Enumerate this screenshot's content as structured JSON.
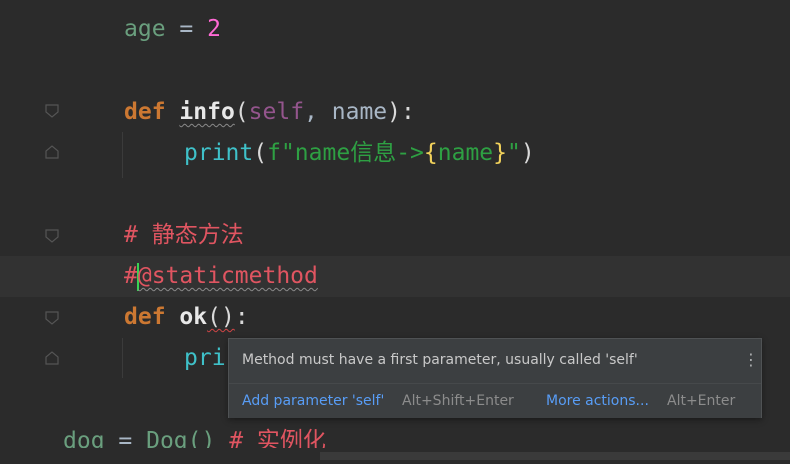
{
  "editor": {
    "lines": {
      "age": {
        "name": "age",
        "op": " = ",
        "value": "2"
      },
      "def_info": {
        "kw": "def",
        "fn": "info",
        "open": "(",
        "self": "self",
        "comma": ", ",
        "param": "name",
        "close": "):"
      },
      "print_info": {
        "builtin": "print",
        "open": "(",
        "fprefix": "f\"name信息->",
        "lbrace": "{",
        "expr": "name",
        "rbrace": "}",
        "fend": "\"",
        "close": ")"
      },
      "comment_static": {
        "text": "# 静态方法"
      },
      "decorator": {
        "hash": "#",
        "text": "@staticmethod"
      },
      "def_ok": {
        "kw": "def",
        "fn": "ok",
        "parens": "()",
        "colon": ":"
      },
      "print_ok": {
        "text": "pri"
      },
      "dog": {
        "var": "dog",
        "op": " = ",
        "call": "Dog()",
        "comment": " # 实例化"
      }
    }
  },
  "inspection_popup": {
    "message": "Method must have a first parameter, usually called 'self'",
    "more_icon": "⋮",
    "actions": [
      {
        "label": "Add parameter 'self'",
        "shortcut": "Alt+Shift+Enter"
      },
      {
        "label": "More actions...",
        "shortcut": "Alt+Enter"
      }
    ]
  },
  "icons": {
    "fold_open": "fold-open-icon",
    "fold_close": "fold-close-icon",
    "more": "vertical-dots-icon"
  },
  "colors": {
    "background": "#2b2b2b",
    "current_line": "#323232",
    "keyword": "#cc7832",
    "link": "#589df6",
    "comment": "#e05561"
  }
}
